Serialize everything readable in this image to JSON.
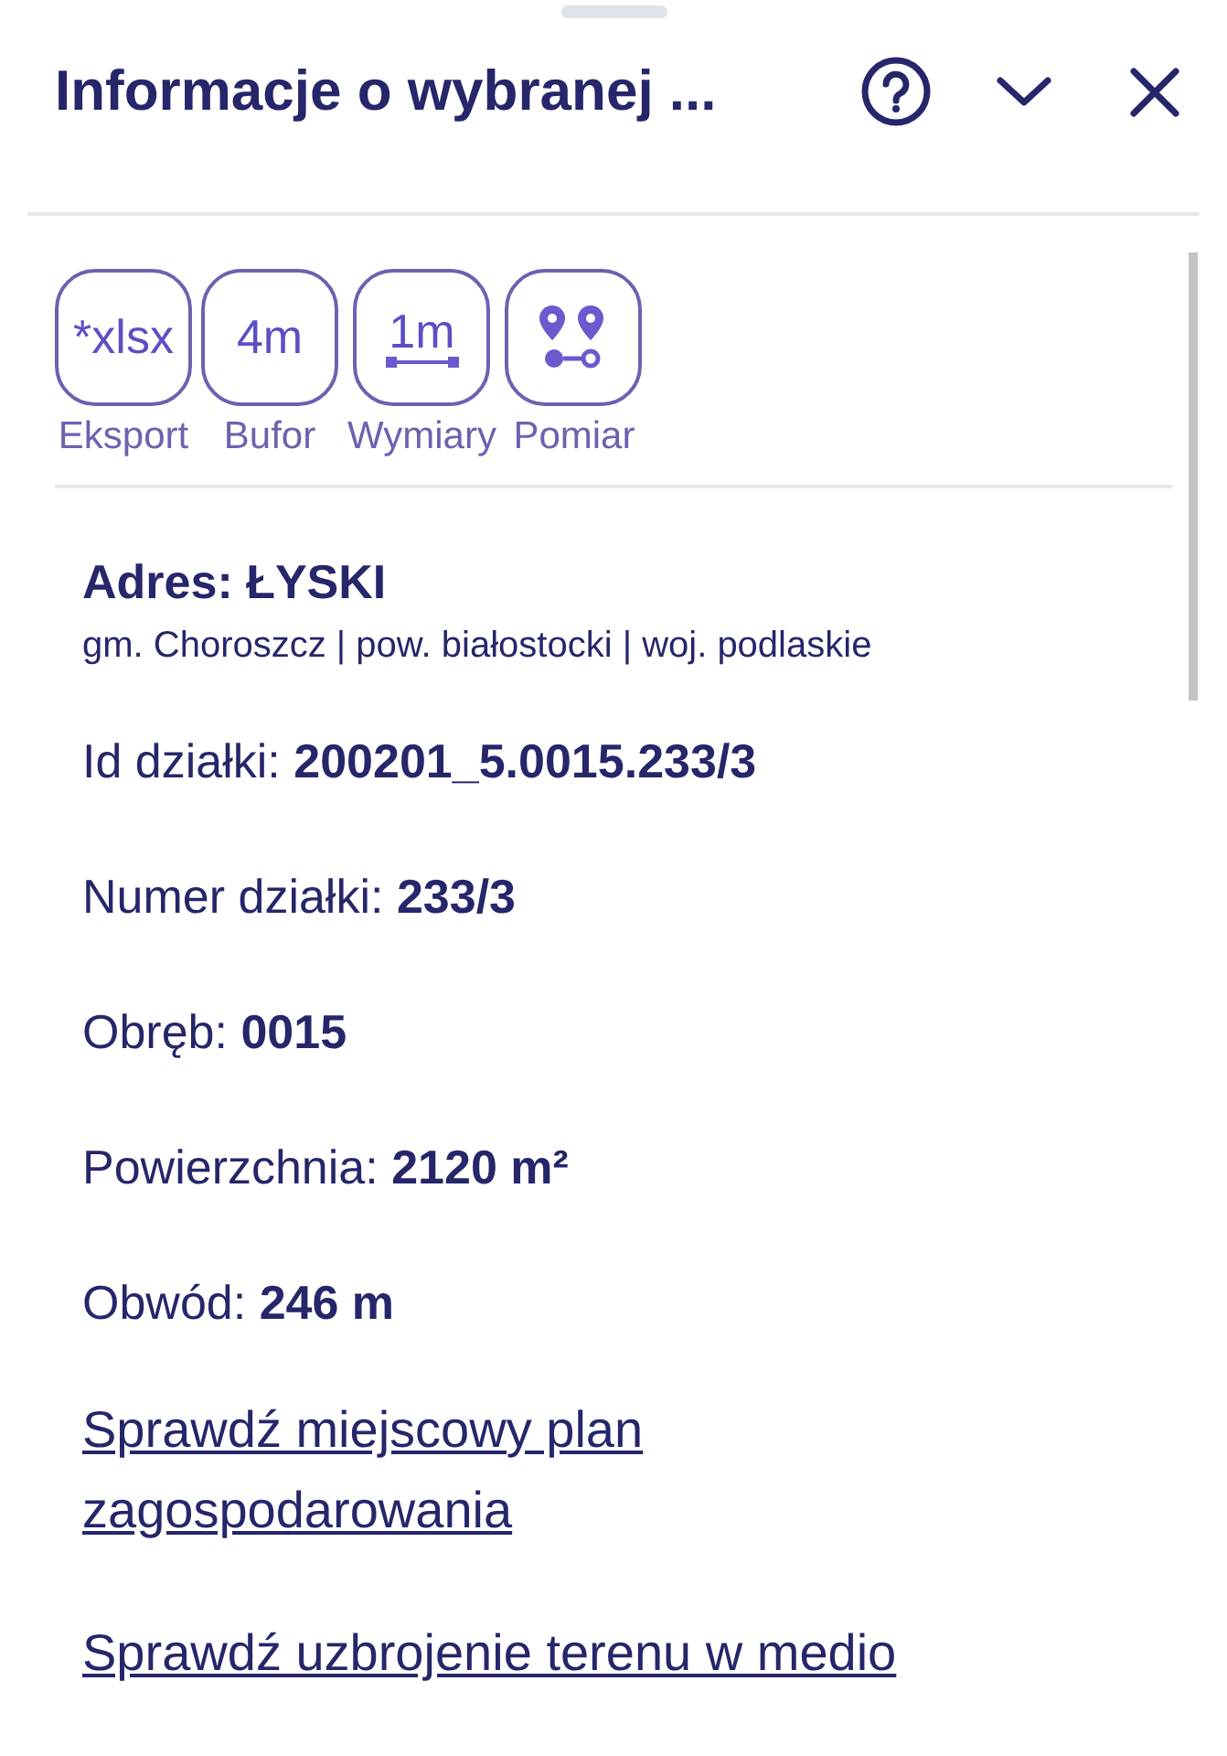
{
  "header": {
    "title": "Informacje o wybranej ..."
  },
  "tools": [
    {
      "kind": "text",
      "icon_text": "*xlsx",
      "label": "Eksport"
    },
    {
      "kind": "text",
      "icon_text": "4m",
      "label": "Bufor"
    },
    {
      "kind": "dimension",
      "icon_text": "1m",
      "label": "Wymiary"
    },
    {
      "kind": "pins",
      "label": "Pomiar"
    }
  ],
  "address": {
    "title": "Adres: ŁYSKI",
    "subtitle": "gm. Choroszcz | pow. białostocki | woj. podlaskie"
  },
  "fields": [
    {
      "label": "Id działki:",
      "value": "200201_5.0015.233/3"
    },
    {
      "label": "Numer działki:",
      "value": "233/3"
    },
    {
      "label": "Obręb:",
      "value": "0015"
    },
    {
      "label": "Powierzchnia:",
      "value": "2120 m²"
    },
    {
      "label": "Obwód:",
      "value": "246 m"
    }
  ],
  "links": [
    "Sprawdź miejscowy plan zagospodarowania",
    "Sprawdź uzbrojenie terenu w medio"
  ]
}
